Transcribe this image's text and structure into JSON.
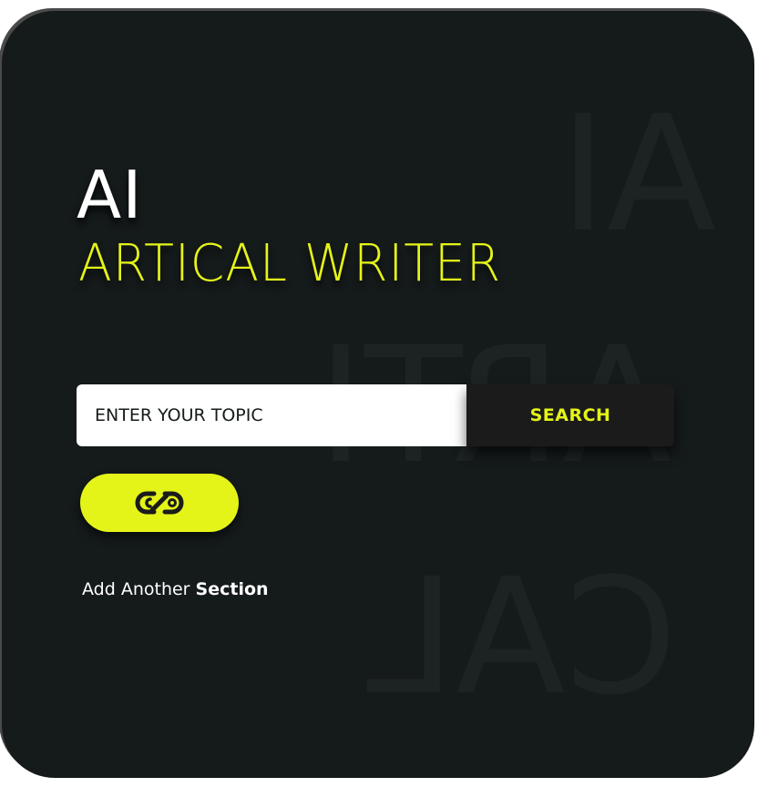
{
  "background_text": {
    "line1": "AI",
    "line2": "ARTI",
    "line3": "CAL"
  },
  "title": {
    "main": "AI",
    "subtitle": "ARTICAL WRITER"
  },
  "search": {
    "placeholder": "ENTER YOUR TOPIC",
    "button_label": "SEARCH"
  },
  "link_button": {
    "icon": "link-chain-icon"
  },
  "add_section": {
    "prefix": "Add Another",
    "emphasis": "Section"
  },
  "colors": {
    "background": "#151a1b",
    "accent": "#e4f418",
    "text": "#ffffff",
    "button_dark": "#1b1b1b"
  }
}
